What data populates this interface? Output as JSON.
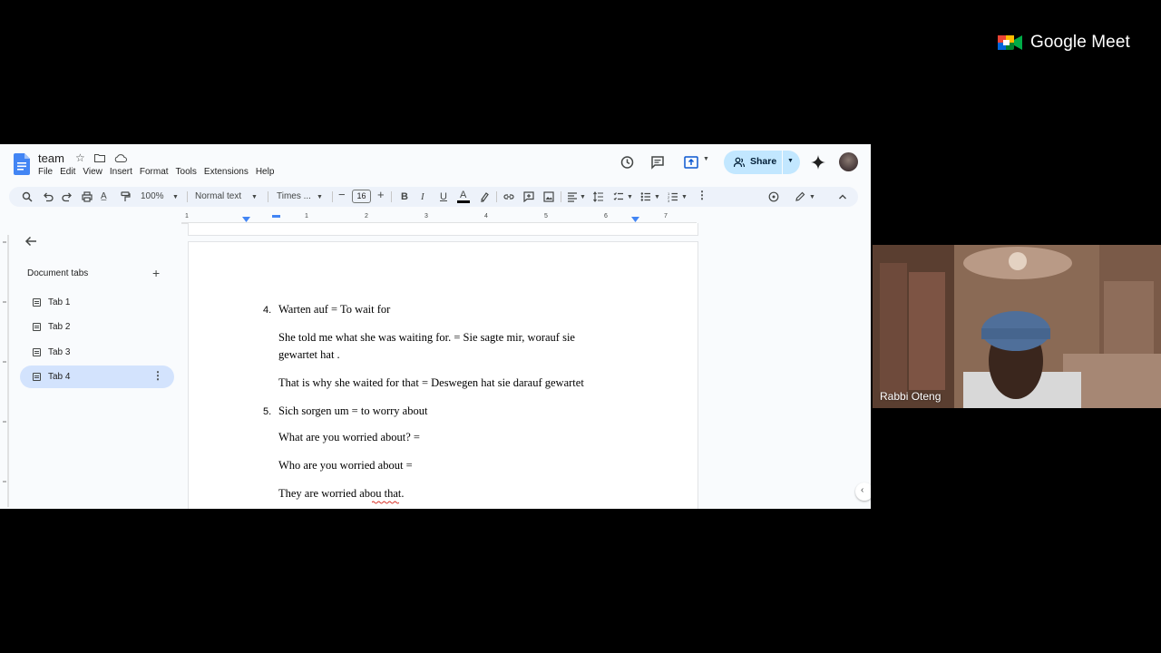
{
  "meet": {
    "brand": "Google Meet",
    "participant_name": "Rabbi Oteng"
  },
  "doc": {
    "title": "team",
    "menu": [
      "File",
      "Edit",
      "View",
      "Insert",
      "Format",
      "Tools",
      "Extensions",
      "Help"
    ],
    "share_label": "Share",
    "toolbar": {
      "zoom": "100%",
      "style": "Normal text",
      "font": "Times ...",
      "font_size": "16"
    },
    "sidebar": {
      "heading": "Document tabs",
      "tabs": [
        {
          "label": "Tab 1"
        },
        {
          "label": "Tab 2"
        },
        {
          "label": "Tab 3"
        },
        {
          "label": "Tab 4",
          "selected": true
        }
      ]
    },
    "ruler_labels": [
      "1",
      "1",
      "2",
      "3",
      "4",
      "5",
      "6",
      "7"
    ],
    "body": [
      {
        "num": "4.",
        "text": "Warten auf  = To wait for"
      },
      {
        "text": "She told me what she was waiting for. = Sie sagte mir, worauf sie"
      },
      {
        "text": "gewartet hat ."
      },
      {
        "text": "That is why she waited for that = Deswegen hat sie darauf gewartet"
      },
      {
        "num": "5.",
        "text": "Sich sorgen um = to worry about"
      },
      {
        "text": "What are you worried about? ="
      },
      {
        "text": "Who are you worried  about ="
      },
      {
        "text": "They are worried abou that."
      }
    ],
    "colors": {
      "accent": "#0b57d0",
      "share_bg": "#c2e7ff",
      "selected_tab_bg": "#d3e3fd",
      "toolbar_bg": "#edf2fa"
    }
  }
}
